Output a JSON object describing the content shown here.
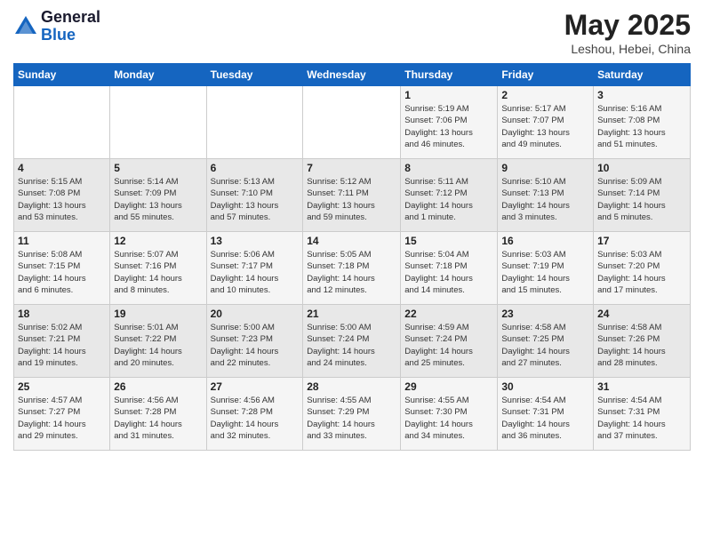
{
  "header": {
    "logo_general": "General",
    "logo_blue": "Blue",
    "month": "May 2025",
    "location": "Leshou, Hebei, China"
  },
  "days_of_week": [
    "Sunday",
    "Monday",
    "Tuesday",
    "Wednesday",
    "Thursday",
    "Friday",
    "Saturday"
  ],
  "weeks": [
    [
      {
        "day": "",
        "info": ""
      },
      {
        "day": "",
        "info": ""
      },
      {
        "day": "",
        "info": ""
      },
      {
        "day": "",
        "info": ""
      },
      {
        "day": "1",
        "info": "Sunrise: 5:19 AM\nSunset: 7:06 PM\nDaylight: 13 hours\nand 46 minutes."
      },
      {
        "day": "2",
        "info": "Sunrise: 5:17 AM\nSunset: 7:07 PM\nDaylight: 13 hours\nand 49 minutes."
      },
      {
        "day": "3",
        "info": "Sunrise: 5:16 AM\nSunset: 7:08 PM\nDaylight: 13 hours\nand 51 minutes."
      }
    ],
    [
      {
        "day": "4",
        "info": "Sunrise: 5:15 AM\nSunset: 7:08 PM\nDaylight: 13 hours\nand 53 minutes."
      },
      {
        "day": "5",
        "info": "Sunrise: 5:14 AM\nSunset: 7:09 PM\nDaylight: 13 hours\nand 55 minutes."
      },
      {
        "day": "6",
        "info": "Sunrise: 5:13 AM\nSunset: 7:10 PM\nDaylight: 13 hours\nand 57 minutes."
      },
      {
        "day": "7",
        "info": "Sunrise: 5:12 AM\nSunset: 7:11 PM\nDaylight: 13 hours\nand 59 minutes."
      },
      {
        "day": "8",
        "info": "Sunrise: 5:11 AM\nSunset: 7:12 PM\nDaylight: 14 hours\nand 1 minute."
      },
      {
        "day": "9",
        "info": "Sunrise: 5:10 AM\nSunset: 7:13 PM\nDaylight: 14 hours\nand 3 minutes."
      },
      {
        "day": "10",
        "info": "Sunrise: 5:09 AM\nSunset: 7:14 PM\nDaylight: 14 hours\nand 5 minutes."
      }
    ],
    [
      {
        "day": "11",
        "info": "Sunrise: 5:08 AM\nSunset: 7:15 PM\nDaylight: 14 hours\nand 6 minutes."
      },
      {
        "day": "12",
        "info": "Sunrise: 5:07 AM\nSunset: 7:16 PM\nDaylight: 14 hours\nand 8 minutes."
      },
      {
        "day": "13",
        "info": "Sunrise: 5:06 AM\nSunset: 7:17 PM\nDaylight: 14 hours\nand 10 minutes."
      },
      {
        "day": "14",
        "info": "Sunrise: 5:05 AM\nSunset: 7:18 PM\nDaylight: 14 hours\nand 12 minutes."
      },
      {
        "day": "15",
        "info": "Sunrise: 5:04 AM\nSunset: 7:18 PM\nDaylight: 14 hours\nand 14 minutes."
      },
      {
        "day": "16",
        "info": "Sunrise: 5:03 AM\nSunset: 7:19 PM\nDaylight: 14 hours\nand 15 minutes."
      },
      {
        "day": "17",
        "info": "Sunrise: 5:03 AM\nSunset: 7:20 PM\nDaylight: 14 hours\nand 17 minutes."
      }
    ],
    [
      {
        "day": "18",
        "info": "Sunrise: 5:02 AM\nSunset: 7:21 PM\nDaylight: 14 hours\nand 19 minutes."
      },
      {
        "day": "19",
        "info": "Sunrise: 5:01 AM\nSunset: 7:22 PM\nDaylight: 14 hours\nand 20 minutes."
      },
      {
        "day": "20",
        "info": "Sunrise: 5:00 AM\nSunset: 7:23 PM\nDaylight: 14 hours\nand 22 minutes."
      },
      {
        "day": "21",
        "info": "Sunrise: 5:00 AM\nSunset: 7:24 PM\nDaylight: 14 hours\nand 24 minutes."
      },
      {
        "day": "22",
        "info": "Sunrise: 4:59 AM\nSunset: 7:24 PM\nDaylight: 14 hours\nand 25 minutes."
      },
      {
        "day": "23",
        "info": "Sunrise: 4:58 AM\nSunset: 7:25 PM\nDaylight: 14 hours\nand 27 minutes."
      },
      {
        "day": "24",
        "info": "Sunrise: 4:58 AM\nSunset: 7:26 PM\nDaylight: 14 hours\nand 28 minutes."
      }
    ],
    [
      {
        "day": "25",
        "info": "Sunrise: 4:57 AM\nSunset: 7:27 PM\nDaylight: 14 hours\nand 29 minutes."
      },
      {
        "day": "26",
        "info": "Sunrise: 4:56 AM\nSunset: 7:28 PM\nDaylight: 14 hours\nand 31 minutes."
      },
      {
        "day": "27",
        "info": "Sunrise: 4:56 AM\nSunset: 7:28 PM\nDaylight: 14 hours\nand 32 minutes."
      },
      {
        "day": "28",
        "info": "Sunrise: 4:55 AM\nSunset: 7:29 PM\nDaylight: 14 hours\nand 33 minutes."
      },
      {
        "day": "29",
        "info": "Sunrise: 4:55 AM\nSunset: 7:30 PM\nDaylight: 14 hours\nand 34 minutes."
      },
      {
        "day": "30",
        "info": "Sunrise: 4:54 AM\nSunset: 7:31 PM\nDaylight: 14 hours\nand 36 minutes."
      },
      {
        "day": "31",
        "info": "Sunrise: 4:54 AM\nSunset: 7:31 PM\nDaylight: 14 hours\nand 37 minutes."
      }
    ]
  ]
}
